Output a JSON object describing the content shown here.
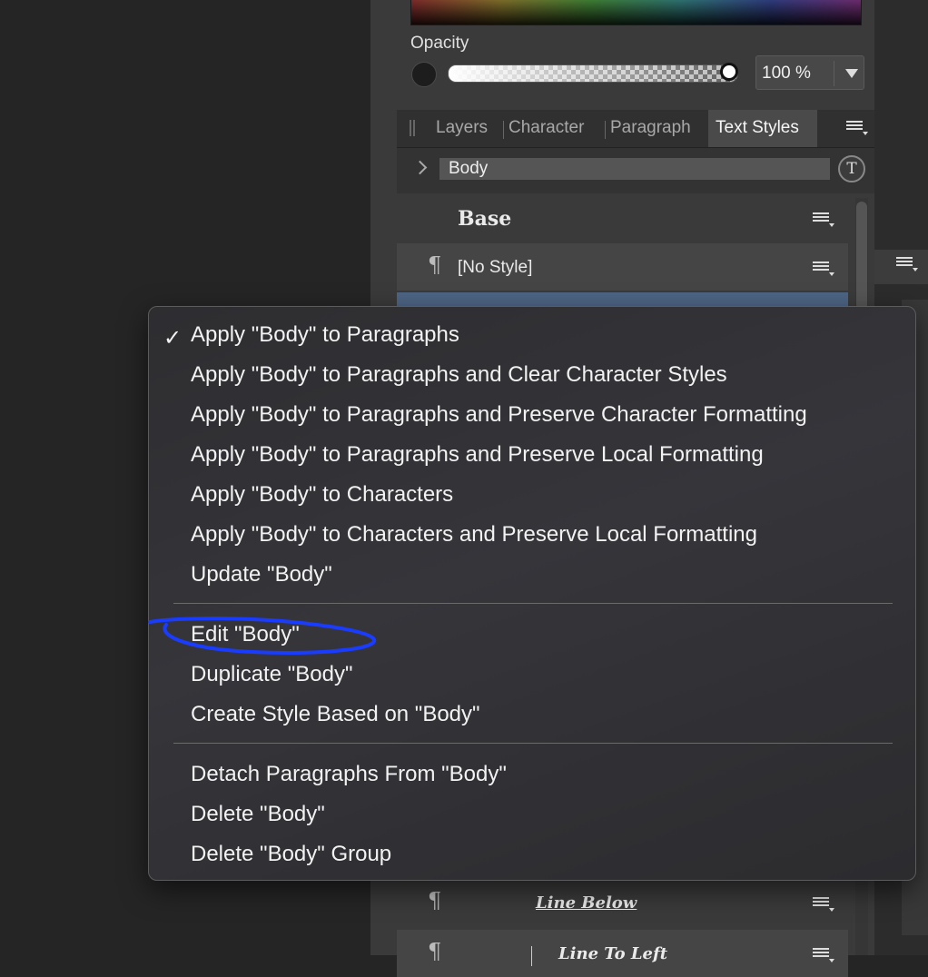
{
  "opacity": {
    "label": "Opacity",
    "value": "100 %",
    "level": 1.0
  },
  "tabs": {
    "layers": "Layers",
    "character": "Character",
    "paragraph": "Paragraph",
    "text_styles": "Text Styles"
  },
  "style_field": {
    "value": "Body",
    "type_icon": "T"
  },
  "style_rows": [
    {
      "label": "Base"
    },
    {
      "label": "[No Style]"
    },
    {
      "label": "Line Below"
    },
    {
      "label": "Line To Left"
    }
  ],
  "context_menu": {
    "group1": [
      "Apply \"Body\" to Paragraphs",
      "Apply \"Body\" to Paragraphs and Clear Character Styles",
      "Apply \"Body\" to Paragraphs and Preserve Character Formatting",
      "Apply \"Body\" to Paragraphs and Preserve Local Formatting",
      "Apply \"Body\" to Characters",
      "Apply \"Body\" to Characters and Preserve Local Formatting",
      "Update \"Body\""
    ],
    "group2": [
      "Edit \"Body\"",
      "Duplicate \"Body\"",
      "Create Style Based on \"Body\""
    ],
    "group3": [
      "Detach Paragraphs From \"Body\"",
      "Delete \"Body\"",
      "Delete \"Body\" Group"
    ],
    "checked_item": "Apply \"Body\" to Paragraphs"
  },
  "colors": {
    "annotation": "#1a3cff",
    "selected_row": "#4d6584"
  }
}
